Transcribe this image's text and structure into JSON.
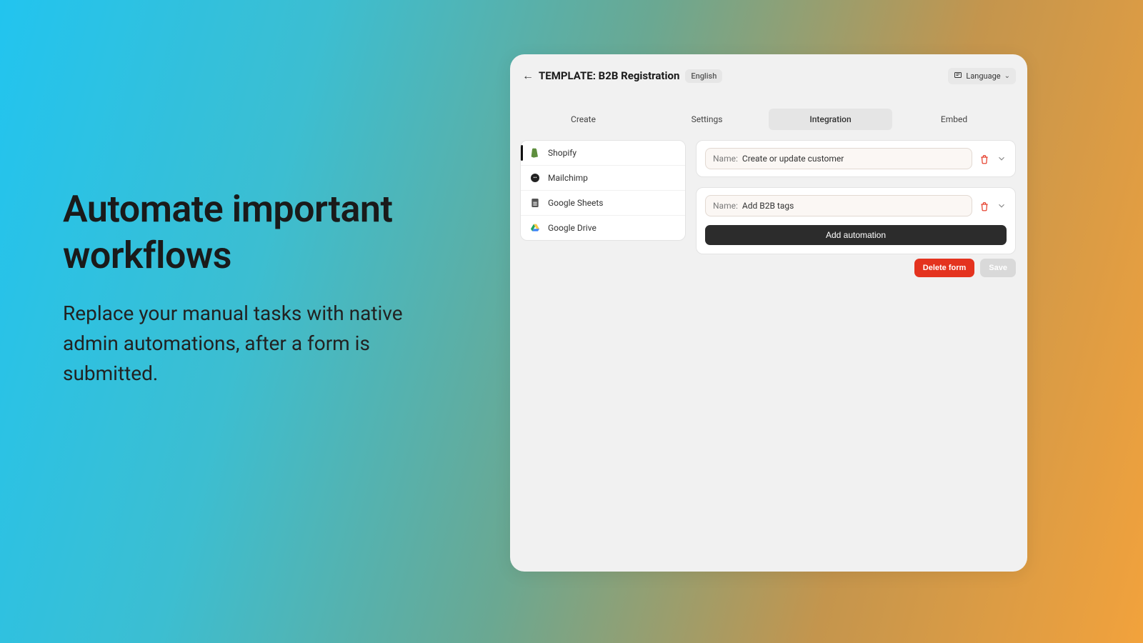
{
  "marketing": {
    "headline": "Automate important workflows",
    "subcopy": "Replace your manual tasks with native admin automations, after a form is submitted."
  },
  "header": {
    "back": "←",
    "title": "TEMPLATE: B2B Registration",
    "lang_badge": "English",
    "language_label": "Language"
  },
  "tabs": {
    "items": [
      "Create",
      "Settings",
      "Integration",
      "Embed"
    ],
    "active_index": 2
  },
  "sidebar": {
    "items": [
      {
        "label": "Shopify"
      },
      {
        "label": "Mailchimp"
      },
      {
        "label": "Google Sheets"
      },
      {
        "label": "Google Drive"
      }
    ],
    "selected_index": 0
  },
  "automations": {
    "name_label": "Name:",
    "rows": [
      {
        "value": "Create or update customer"
      },
      {
        "value": "Add B2B tags"
      }
    ],
    "add_label": "Add automation"
  },
  "actions": {
    "delete": "Delete form",
    "save": "Save"
  }
}
